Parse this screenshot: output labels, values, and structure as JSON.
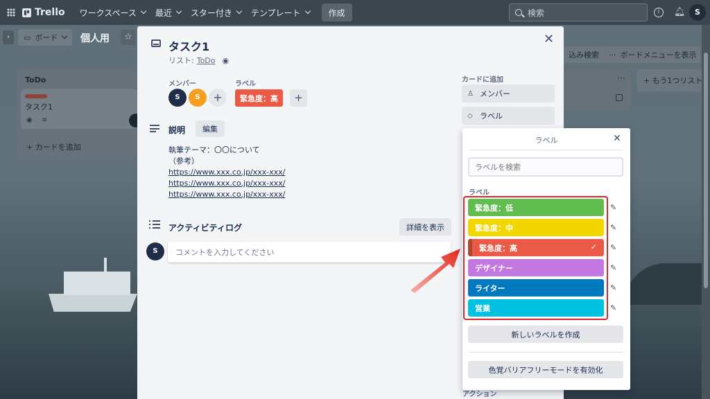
{
  "topbar": {
    "logo": "Trello",
    "nav": [
      "ワークスペース",
      "最近",
      "スター付き",
      "テンプレート"
    ],
    "create": "作成",
    "search_placeholder": "検索",
    "avatar": "S"
  },
  "board": {
    "view_label": "ボード",
    "title": "個人用",
    "filter_label": "込み検索",
    "menu_label": "ボードメニューを表示",
    "list_title": "ToDo",
    "card_title": "タスク1",
    "add_card": "+ カードを追加",
    "add_list": "+ もう1つリスト"
  },
  "card": {
    "title": "タスク1",
    "list_prefix": "リスト:",
    "list_name": "ToDo",
    "members_label": "メンバー",
    "labels_label": "ラベル",
    "members": [
      {
        "initial": "S",
        "color": "#1f2e48"
      },
      {
        "initial": "S",
        "color": "#f59f20"
      }
    ],
    "applied_label": {
      "name": "緊急度：高",
      "color": "#eb5a46"
    },
    "description_title": "説明",
    "edit_button": "編集",
    "description_lines": [
      "執筆テーマ：〇〇について",
      "（参考）"
    ],
    "description_links": [
      "https://www.xxx.co.jp/xxx-xxx/",
      "https://www.xxx.co.jp/xxx-xxx/",
      "https://www.xxx.co.jp/xxx-xxx/"
    ],
    "activity_title": "アクティビティログ",
    "details_button": "詳細を表示",
    "comment_avatar": "S",
    "comment_placeholder": "コメントを入力してください",
    "add_to_card": "カードに追加",
    "side_buttons": [
      "メンバー",
      "ラベル"
    ],
    "actions_label": "アクション"
  },
  "label_popover": {
    "title": "ラベル",
    "search_placeholder": "ラベルを検索",
    "section": "ラベル",
    "labels": [
      {
        "name": "緊急度：低",
        "color": "#61bd4f",
        "checked": false
      },
      {
        "name": "緊急度：中",
        "color": "#f2d600",
        "checked": false
      },
      {
        "name": "緊急度：高",
        "color": "#eb5a46",
        "checked": true
      },
      {
        "name": "デザイナー",
        "color": "#c377e0",
        "checked": false
      },
      {
        "name": "ライター",
        "color": "#0079bf",
        "checked": false
      },
      {
        "name": "営業",
        "color": "#00c2e0",
        "checked": false
      }
    ],
    "check_mark": "✓",
    "create_button": "新しいラベルを作成",
    "colorblind_button": "色覚バリアフリーモードを有効化"
  }
}
